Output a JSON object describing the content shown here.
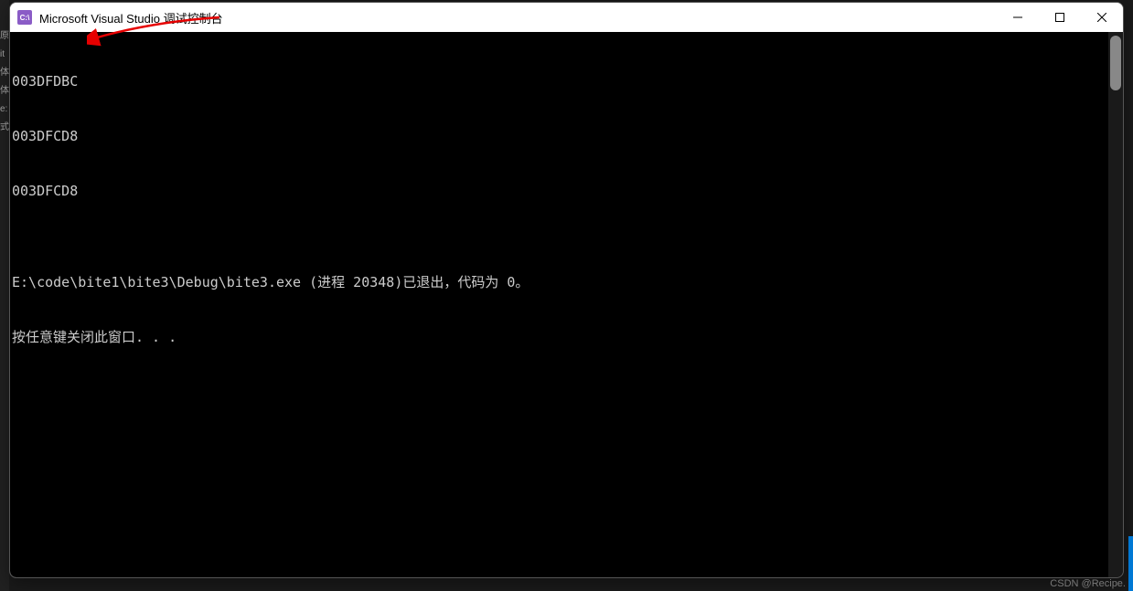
{
  "window": {
    "title": "Microsoft Visual Studio 调试控制台",
    "icon_label": "C:\\"
  },
  "gutter": {
    "items": [
      "原",
      "it",
      "",
      "",
      "体",
      "体",
      "e:",
      "式"
    ]
  },
  "console": {
    "lines": [
      "003DFDBC",
      "003DFCD8",
      "003DFCD8",
      "",
      "E:\\code\\bite1\\bite3\\Debug\\bite3.exe (进程 20348)已退出，代码为 0。",
      "按任意键关闭此窗口. . ."
    ]
  },
  "watermark": "CSDN @Recipe."
}
